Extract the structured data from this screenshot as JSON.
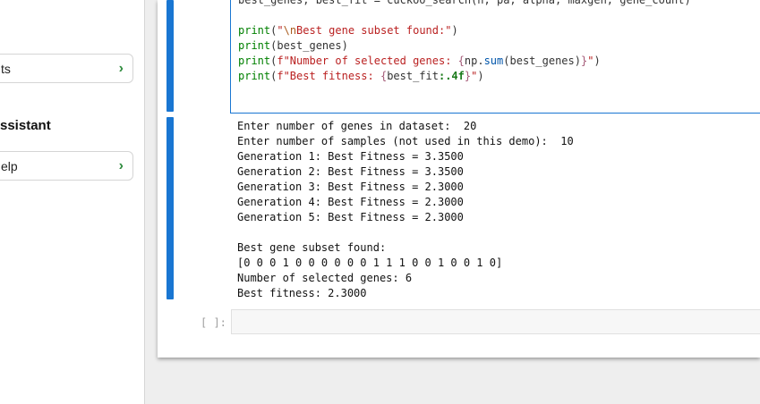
{
  "sidebar": {
    "card1_label": "ts",
    "section_title": "ssistant",
    "card2_label": "elp",
    "chevron": "›"
  },
  "code_cell": {
    "lines": [
      {
        "parts": [
          {
            "t": "best_genes, best_fit = cuckoo_search(n, pa, alpha, maxgen, gene_count)",
            "c": ""
          }
        ]
      },
      {
        "parts": [
          {
            "t": "",
            "c": ""
          }
        ]
      },
      {
        "parts": [
          {
            "t": "print",
            "c": "kw-fn"
          },
          {
            "t": "(",
            "c": ""
          },
          {
            "t": "\"",
            "c": "str"
          },
          {
            "t": "\\n",
            "c": "esc"
          },
          {
            "t": "Best gene subset found:\"",
            "c": "str"
          },
          {
            "t": ")",
            "c": ""
          }
        ]
      },
      {
        "parts": [
          {
            "t": "print",
            "c": "kw-fn"
          },
          {
            "t": "(best_genes)",
            "c": ""
          }
        ]
      },
      {
        "parts": [
          {
            "t": "print",
            "c": "kw-fn"
          },
          {
            "t": "(",
            "c": ""
          },
          {
            "t": "f\"Number of selected genes: ",
            "c": "str"
          },
          {
            "t": "{",
            "c": "brace"
          },
          {
            "t": "np.",
            "c": "np"
          },
          {
            "t": "sum",
            "c": "attr"
          },
          {
            "t": "(best_genes)",
            "c": ""
          },
          {
            "t": "}",
            "c": "brace"
          },
          {
            "t": "\"",
            "c": "str"
          },
          {
            "t": ")",
            "c": ""
          }
        ]
      },
      {
        "parts": [
          {
            "t": "print",
            "c": "kw-fn"
          },
          {
            "t": "(",
            "c": ""
          },
          {
            "t": "f\"Best fitness: ",
            "c": "str"
          },
          {
            "t": "{",
            "c": "brace"
          },
          {
            "t": "best_fit",
            "c": ""
          },
          {
            "t": ":.4f",
            "c": "fmt"
          },
          {
            "t": "}",
            "c": "brace"
          },
          {
            "t": "\"",
            "c": "str"
          },
          {
            "t": ")",
            "c": ""
          }
        ]
      }
    ]
  },
  "output": {
    "lines": [
      "Enter number of genes in dataset:  20",
      "Enter number of samples (not used in this demo):  10",
      "Generation 1: Best Fitness = 3.3500",
      "Generation 2: Best Fitness = 3.3500",
      "Generation 3: Best Fitness = 2.3000",
      "Generation 4: Best Fitness = 2.3000",
      "Generation 5: Best Fitness = 2.3000",
      "",
      "Best gene subset found:",
      "[0 0 0 1 0 0 0 0 0 0 1 1 1 0 0 1 0 0 1 0]",
      "Number of selected genes: 6",
      "Best fitness: 2.3000"
    ]
  },
  "empty_cell": {
    "prompt": "[ ]:"
  },
  "colors": {
    "accent": "#1976d2",
    "chevron": "#2e8b3d"
  }
}
